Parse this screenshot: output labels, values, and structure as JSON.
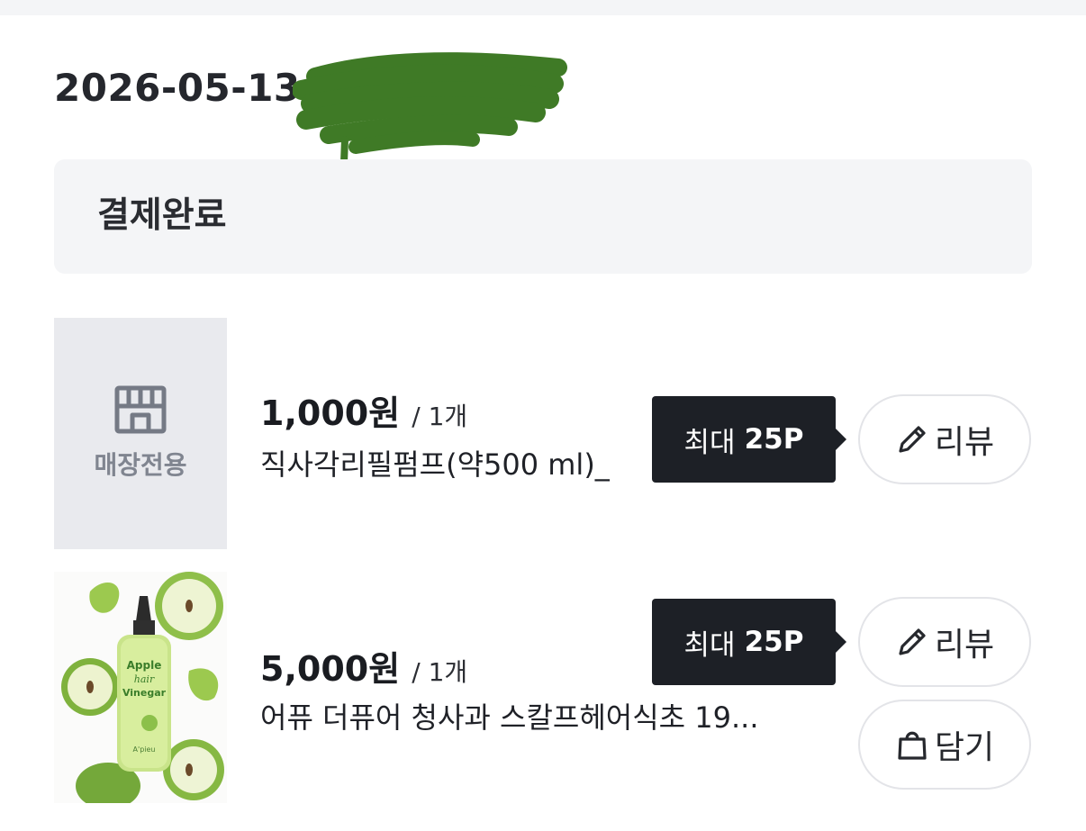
{
  "order": {
    "date": "2026-05-13",
    "status": "결제완료"
  },
  "items": [
    {
      "thumbnail": "store-only-placeholder",
      "thumbnail_label": "매장전용",
      "price": "1,000원",
      "quantity": "/ 1개",
      "name": "직사각리필펌프(약500 ml)_",
      "points_prefix": "최대",
      "points_value": "25P",
      "review_label": "리뷰"
    },
    {
      "thumbnail": "apple-hair-vinegar-product-photo",
      "thumbnail_text": {
        "line1": "Apple",
        "line2": "hair",
        "line3": "Vinegar",
        "brand": "A'pieu"
      },
      "price": "5,000원",
      "quantity": "/ 1개",
      "name": "어퓨 더퓨어 청사과 스칼프헤어식초 19...",
      "points_prefix": "최대",
      "points_value": "25P",
      "review_label": "리뷰",
      "cart_label": "담기"
    }
  ],
  "icons": {
    "store": "store-icon",
    "pencil": "pencil-icon",
    "bag": "shopping-bag-icon"
  },
  "colors": {
    "tooltip_bg": "#1d2026",
    "status_bg": "#f4f5f7",
    "placeholder_bg": "#e9eaee",
    "redaction": "#3f7a26"
  }
}
